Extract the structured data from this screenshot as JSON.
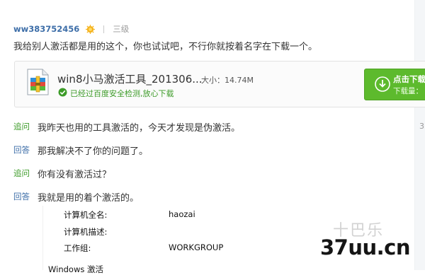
{
  "header": {
    "username": "ww383752456",
    "level": "三级"
  },
  "answer": {
    "text": "我给别人激活都是用的这个，你也试试吧，不行你就按着名字在下载一个。"
  },
  "attachment": {
    "file_name": "win8小马激活工具_201306...",
    "size_label": "大小：14.74M",
    "safe_text": "已经过百度安全检测,放心下载",
    "download_label": "点击下载",
    "download_count_label": "下载量："
  },
  "thread": [
    {
      "label": "追问",
      "kind": "follow",
      "text": "我昨天也用的工具激活的，今天才发现是伪激活。"
    },
    {
      "label": "回答",
      "kind": "reply",
      "text": "那我解决不了你的问题了。"
    },
    {
      "label": "追问",
      "kind": "follow",
      "text": "你有没有激活过？"
    },
    {
      "label": "回答",
      "kind": "reply",
      "text": "我就是用的着个激活的。"
    }
  ],
  "side_number": "3",
  "system_info": {
    "rows": [
      {
        "key": "计算机全名:",
        "value": "haozai"
      },
      {
        "key": "计算机描述:",
        "value": ""
      },
      {
        "key": "工作组:",
        "value": "WORKGROUP"
      }
    ],
    "section_heading": "Windows 激活"
  },
  "watermark": {
    "text": "十巴乐",
    "brand": "37uu.cn"
  },
  "colors": {
    "link_blue": "#3d6ea8",
    "follow_green": "#3c9b28",
    "download_green": "#5dba2d"
  },
  "icons": [
    "level-medal-icon",
    "zip-file-icon",
    "safe-check-icon",
    "download-arrow-icon"
  ]
}
